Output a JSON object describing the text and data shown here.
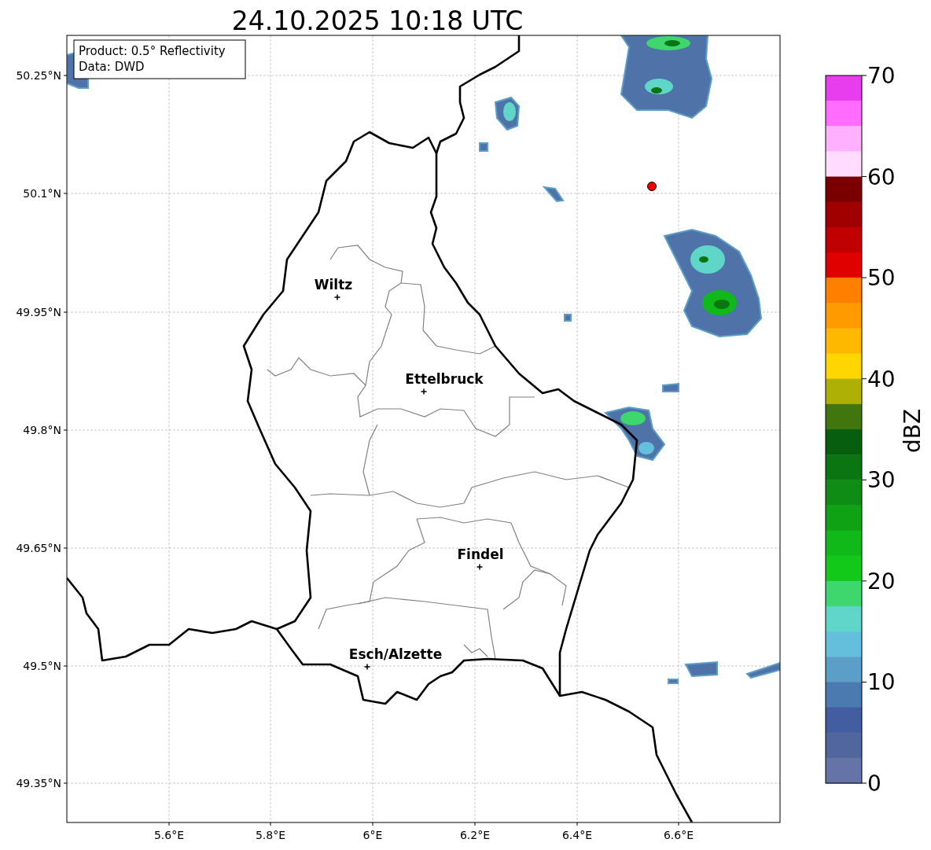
{
  "title": "24.10.2025 10:18 UTC",
  "info_box": [
    "Product: 0.5° Reflectivity",
    "Data: DWD"
  ],
  "map": {
    "lat_ticks": [
      "50.25°N",
      "50.1°N",
      "49.95°N",
      "49.8°N",
      "49.65°N",
      "49.5°N",
      "49.35°N"
    ],
    "lon_ticks": [
      "5.6°E",
      "5.8°E",
      "6°E",
      "6.2°E",
      "6.4°E",
      "6.6°E"
    ],
    "places": [
      {
        "name": "Wiltz"
      },
      {
        "name": "Ettelbruck"
      },
      {
        "name": "Findel"
      },
      {
        "name": "Esch/Alzette"
      }
    ]
  },
  "colorbar": {
    "label": "dBZ",
    "ticks": [
      "70",
      "60",
      "50",
      "40",
      "30",
      "20",
      "10",
      "0"
    ],
    "segments": [
      {
        "color": "#e83cef"
      },
      {
        "color": "#ff6cff"
      },
      {
        "color": "#ffb0ff"
      },
      {
        "color": "#ffdcff"
      },
      {
        "color": "#7a0000"
      },
      {
        "color": "#a00000"
      },
      {
        "color": "#c00000"
      },
      {
        "color": "#e00000"
      },
      {
        "color": "#ff7f00"
      },
      {
        "color": "#ff9a00"
      },
      {
        "color": "#ffb800"
      },
      {
        "color": "#ffd600"
      },
      {
        "color": "#afb005"
      },
      {
        "color": "#41750e"
      },
      {
        "color": "#075e0e"
      },
      {
        "color": "#0b7512"
      },
      {
        "color": "#0e8c14"
      },
      {
        "color": "#0fa214"
      },
      {
        "color": "#10b81a"
      },
      {
        "color": "#12c91a"
      },
      {
        "color": "#3dd76e"
      },
      {
        "color": "#5fd6c8"
      },
      {
        "color": "#64bfdc"
      },
      {
        "color": "#5b9fc8"
      },
      {
        "color": "#4a7ab0"
      },
      {
        "color": "#435ea0"
      },
      {
        "color": "#52669e"
      },
      {
        "color": "#6573a6"
      }
    ]
  }
}
